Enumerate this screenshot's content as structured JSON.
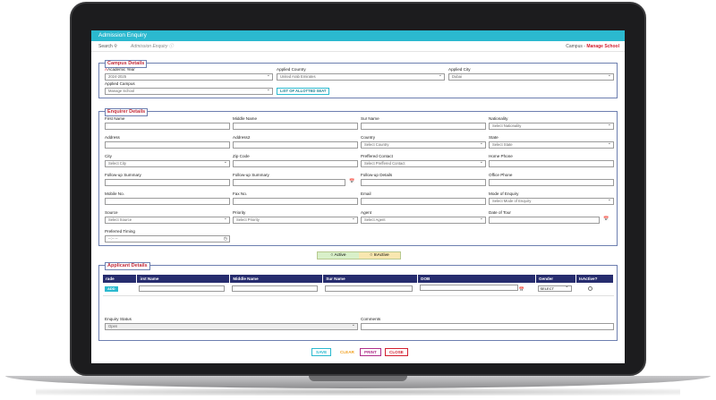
{
  "app": {
    "title": "Admission Enquiry",
    "search_label": "Search",
    "breadcrumb": "Admission Enquiry",
    "campus_label": "Campus -",
    "campus_link": "Manage School"
  },
  "campus": {
    "legend": "Campus Details",
    "academic_year": {
      "label": "Academic Year",
      "value": "2024-2025"
    },
    "applied_country": {
      "label": "Applied Country",
      "value": "United Arab Emirates"
    },
    "applied_city": {
      "label": "Applied City",
      "value": "Dubai"
    },
    "applied_campus": {
      "label": "Applied Campus",
      "value": "Manage School"
    },
    "allotted_seat_button": "LIST OF ALLOTTED SEAT"
  },
  "enquirer": {
    "legend": "Enquirer Details",
    "fields": {
      "first_name": {
        "label": "First Name",
        "value": ""
      },
      "middle_name": {
        "label": "Middle Name",
        "value": ""
      },
      "sur_name": {
        "label": "Sur Name",
        "value": ""
      },
      "nationality": {
        "label": "Nationality",
        "value": "Select Nationality"
      },
      "address": {
        "label": "Address",
        "value": ""
      },
      "address2": {
        "label": "Address2",
        "value": ""
      },
      "country": {
        "label": "Country",
        "value": "Select Country"
      },
      "state": {
        "label": "State",
        "value": "Select State"
      },
      "city": {
        "label": "City",
        "value": "Select City"
      },
      "zip_code": {
        "label": "Zip Code",
        "value": ""
      },
      "preffered_contact": {
        "label": "Preffered Contact",
        "value": "Select Preffered Contact"
      },
      "home_phone": {
        "label": "Home Phone",
        "value": ""
      },
      "followup_summary_1": {
        "label": "Follow-up Summary",
        "value": ""
      },
      "followup_summary_2": {
        "label": "Follow-up Summary",
        "value": ""
      },
      "followup_details": {
        "label": "Follow-up Details",
        "value": ""
      },
      "office_phone": {
        "label": "Office Phone",
        "value": ""
      },
      "mobile_no": {
        "label": "Mobile No.",
        "value": ""
      },
      "fax_no": {
        "label": "Fax No.",
        "value": ""
      },
      "email": {
        "label": "Email",
        "value": ""
      },
      "mode_of_enquiry": {
        "label": "Mode of Enquiry",
        "value": "Select Mode of Enquiry"
      },
      "source": {
        "label": "Source",
        "value": "Select Source"
      },
      "priority": {
        "label": "Priority",
        "value": "Select Priority"
      },
      "agent": {
        "label": "Agent",
        "value": "Select Agent"
      },
      "date_of_tour": {
        "label": "Date of Tour",
        "value": ""
      },
      "preferred_timing": {
        "label": "Preferred Timing",
        "value": "--:-- --"
      }
    }
  },
  "status_toggle": {
    "active": "Active",
    "inactive": "InActive"
  },
  "applicant": {
    "legend": "Applicant Details",
    "columns": [
      "rade",
      "irst Name",
      "Middle Name",
      "Sur Name",
      "DOB",
      "Gender",
      "IsActive?"
    ],
    "add_label": "ADD",
    "gender_value": "SELECT",
    "enquiry_status": {
      "label": "Enquiry Status",
      "value": "Open"
    },
    "comments": {
      "label": "Comments",
      "value": ""
    }
  },
  "actions": {
    "save": "SAVE",
    "clear": "CLEAR",
    "print": "PRINT",
    "close": "CLOSE"
  },
  "colors": {
    "header": "#2bb9cf",
    "table_header": "#262c6e",
    "accent_red": "#d32030"
  }
}
